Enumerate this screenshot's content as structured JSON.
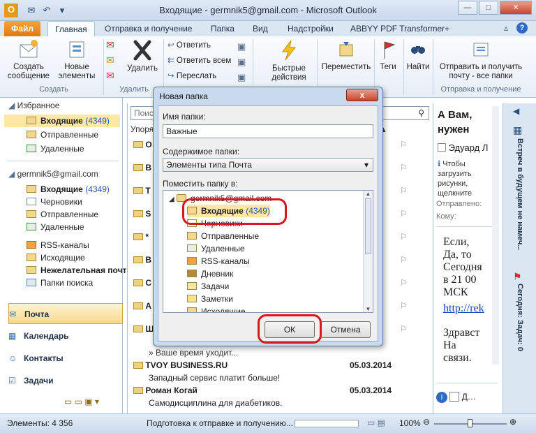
{
  "window": {
    "title": "Входящие - germnik5@gmail.com  -  Microsoft Outlook"
  },
  "tabs": [
    "Файл",
    "Главная",
    "Отправка и получение",
    "Папка",
    "Вид",
    "Надстройки",
    "ABBYY PDF Transformer+"
  ],
  "ribbon": {
    "create_message": "Создать сообщение",
    "new_items": "Новые элементы",
    "group_create": "Создать",
    "delete": "Удалить",
    "group_delete": "Удалить",
    "reply": "Ответить",
    "reply_all": "Ответить всем",
    "forward": "Переслать",
    "quick_steps": "Быстрые действия",
    "move": "Переместить",
    "tags": "Теги",
    "find": "Найти",
    "send_receive_all": "Отправить и получить почту - все папки",
    "group_send_receive": "Отправка и получение"
  },
  "nav": {
    "favorites_header": "Избранное",
    "favorites": [
      {
        "label": "Входящие",
        "count": "(4349)"
      },
      {
        "label": "Отправленные"
      },
      {
        "label": "Удаленные"
      }
    ],
    "account": "germnik5@gmail.com",
    "folders": [
      {
        "label": "Входящие",
        "count": "(4349)"
      },
      {
        "label": "Черновики"
      },
      {
        "label": "Отправленные"
      },
      {
        "label": "Удаленные"
      },
      {
        "label": "RSS-каналы"
      },
      {
        "label": "Исходящие"
      },
      {
        "label": "Нежелательная почт"
      },
      {
        "label": "Папки поиска"
      }
    ],
    "modules": [
      "Почта",
      "Календарь",
      "Контакты",
      "Задачи"
    ]
  },
  "list": {
    "search_placeholder": "Поиск",
    "sort_label": "Упоря",
    "rows": [
      {
        "from": "О",
        "preview": ""
      },
      {
        "from": "В",
        "preview": ""
      },
      {
        "from": "Т",
        "preview": ""
      },
      {
        "from": "S",
        "preview": ""
      },
      {
        "from": "*",
        "preview": ""
      },
      {
        "from": "В",
        "preview": ""
      },
      {
        "from": "С",
        "preview": ""
      },
      {
        "from": "А",
        "preview": ""
      },
      {
        "from": "Ш",
        "preview": ""
      }
    ],
    "tail_preview": "» Ваше время уходит...",
    "msg1_from": "TVOY BUSINESS.RU",
    "msg1_date": "05.03.2014",
    "msg1_subject": "Западный сервис платит больше!",
    "msg2_from": "Роман Когай",
    "msg2_date": "05.03.2014",
    "msg2_subject": "Самодисциплина для диабетиков."
  },
  "reading": {
    "subject": "А Вам, нужен",
    "sender": "Эдуард Л",
    "info": "Чтобы загрузить рисунки, щелкните",
    "sent_label": "Отправлено:",
    "sent_val": "С",
    "to_label": "Кому:",
    "body": [
      "Если,",
      "Да, то",
      "Сегодня",
      "в 21 00",
      "МСК"
    ],
    "link": "http://rek",
    "body2": [
      "Здравст",
      "На",
      "связи."
    ],
    "footer": "Д"
  },
  "todo": {
    "top": "Встреч в будущем не намеч...",
    "bottom": "Сегодня: Задач: 0"
  },
  "status": {
    "items": "Элементы: 4 356",
    "progress": "Подготовка к отправке и получению...",
    "zoom": "100%"
  },
  "dialog": {
    "title": "Новая папка",
    "close": "x",
    "name_label": "Имя папки:",
    "name_value": "Важные",
    "content_label": "Содержимое папки:",
    "content_value": "Элементы типа Почта",
    "place_label": "Поместить папку в:",
    "account": "germnik5@gmail.com",
    "tree": [
      {
        "label": "Входящие",
        "count": "(4349)"
      },
      {
        "label": "Черновики"
      },
      {
        "label": "Отправленные"
      },
      {
        "label": "Удаленные"
      },
      {
        "label": "RSS-каналы"
      },
      {
        "label": "Дневник"
      },
      {
        "label": "Задачи"
      },
      {
        "label": "Заметки"
      },
      {
        "label": "Исходящие"
      }
    ],
    "ok": "ОК",
    "cancel": "Отмена"
  },
  "colors": {
    "accent": "#d6171c",
    "file_tab": "#e07a12",
    "selection": "#fce7a6"
  }
}
